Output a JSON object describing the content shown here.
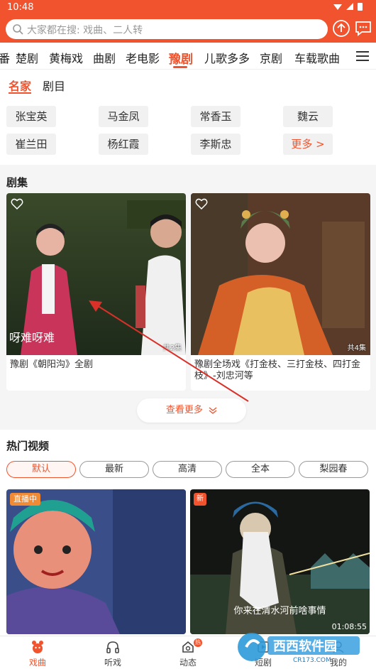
{
  "status_bar": {
    "time": "10:48"
  },
  "search": {
    "placeholder": "大家都在搜: 戏曲、二人转"
  },
  "icons": {
    "search": "search-icon",
    "upload": "upload-icon",
    "message": "message-icon",
    "menu": "menu-icon",
    "heart": "heart-icon",
    "chevron": "chevron-down-icon"
  },
  "category_tabs": [
    "番",
    "楚剧",
    "黄梅戏",
    "曲剧",
    "老电影",
    "豫剧",
    "儿歌多多",
    "京剧",
    "车载歌曲"
  ],
  "active_category": "豫剧",
  "sub_tabs": [
    "名家",
    "剧目"
  ],
  "artists": [
    "张宝英",
    "马金凤",
    "常香玉",
    "魏云",
    "崔兰田",
    "杨红霞",
    "李斯忠"
  ],
  "artists_more": "更多 >",
  "series_section": {
    "title": "剧集",
    "cards": [
      {
        "title": "豫剧《朝阳沟》全剧",
        "count": "共2集",
        "caption": "呀难呀难"
      },
      {
        "title": "豫剧全场戏《打金枝、三打金枝、四打金枝》-刘忠河等",
        "count": "共4集"
      }
    ],
    "more_label": "查看更多"
  },
  "hot_section": {
    "title": "热门视频",
    "filters": [
      "默认",
      "最新",
      "高清",
      "全本",
      "梨园春"
    ],
    "active_filter": "默认",
    "videos": [
      {
        "badge": "直播中"
      },
      {
        "badge": "新",
        "subtitle": "你来在清水河前啥事情",
        "duration": "01:08:55"
      }
    ]
  },
  "bottom_nav": [
    {
      "label": "戏曲",
      "icon": "opera-icon",
      "active": true
    },
    {
      "label": "听戏",
      "icon": "headphones-icon"
    },
    {
      "label": "动态",
      "icon": "dynamic-icon",
      "badge": "热"
    },
    {
      "label": "短剧",
      "icon": "short-drama-icon"
    },
    {
      "label": "我的",
      "icon": "profile-icon"
    }
  ],
  "watermark": {
    "text": "西西软件园",
    "url_text": "CR173.COM"
  },
  "colors": {
    "brand": "#f0532d",
    "background": "#f5f5f5"
  }
}
